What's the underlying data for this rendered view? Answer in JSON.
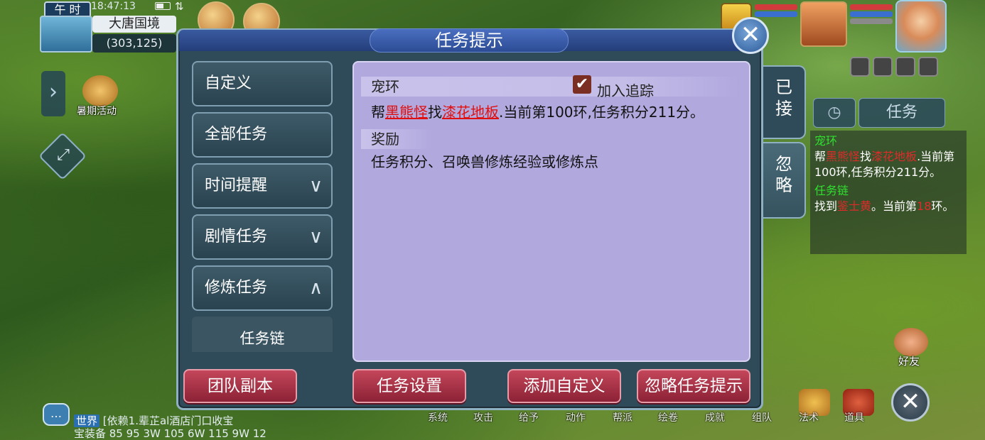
{
  "hud": {
    "time_period": "午 时",
    "clock": "18:47:13",
    "location": "大唐国境",
    "coordinates": "(303,125)",
    "summer_event_label": "暑期活动",
    "friends_label": "好友"
  },
  "dialog": {
    "title": "任务提示",
    "sidebar": [
      {
        "label": "自定义",
        "chevron": ""
      },
      {
        "label": "全部任务",
        "chevron": ""
      },
      {
        "label": "时间提醒",
        "chevron": "∨"
      },
      {
        "label": "剧情任务",
        "chevron": "∨"
      },
      {
        "label": "修炼任务",
        "chevron": "∧"
      }
    ],
    "sidebar_sub_item": "任务链",
    "task": {
      "section_title": "宠环",
      "track_label": "加入追踪",
      "track_checked": true,
      "prefix": "帮",
      "target1": "黑熊怪",
      "middle": "找",
      "target2": "漆花地板",
      "suffix": ".当前第100环,任务积分211分。"
    },
    "reward": {
      "section_title": "奖励",
      "text": "任务积分、召唤兽修炼经验或修炼点"
    },
    "side_tabs": {
      "accepted": "已接",
      "ignored": "忽略"
    },
    "buttons": {
      "team_dungeon": "团队副本",
      "task_settings": "任务设置",
      "add_custom": "添加自定义",
      "ignore_tips": "忽略任务提示"
    }
  },
  "quest_tracker": {
    "tab_label": "任务",
    "entry1_title": "宠环",
    "entry1_prefix": "帮",
    "entry1_t1": "黑熊怪",
    "entry1_mid": "找",
    "entry1_t2": "漆花地板",
    "entry1_suffix": ".当前第100环,任务积分211分。",
    "entry2_title": "任务链",
    "entry2_prefix": "找到",
    "entry2_t1": "鉴士黄",
    "entry2_mid": "。当前第",
    "entry2_num": "18",
    "entry2_suffix": "环。"
  },
  "bottom_bar": [
    "系统",
    "攻击",
    "给予",
    "动作",
    "帮派",
    "绘卷",
    "成就",
    "组队",
    "法术",
    "道具"
  ],
  "chat": {
    "channel": "世界",
    "line1": "[依赖1.辈芷al酒店门口收宝",
    "line2": "宝装备 85 95 3W 105 6W 115 9W 12"
  },
  "colors": {
    "dialog_bg": "#2f4a58",
    "content_bg": "#b1a9de",
    "red_button": "#a8324a",
    "link_red": "#e01010",
    "tracker_green": "#2fe02f"
  }
}
